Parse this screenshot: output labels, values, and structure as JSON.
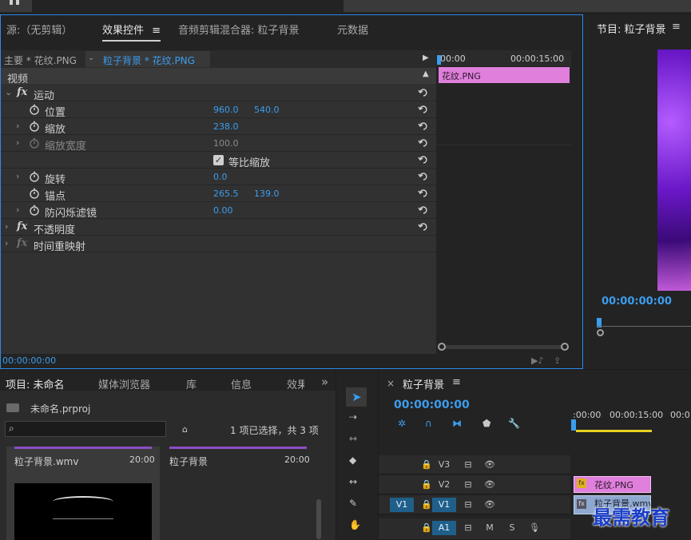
{
  "effect_controls": {
    "tabs": [
      {
        "label": "源:（无剪辑）"
      },
      {
        "label": "效果控件"
      },
      {
        "label": "音频剪辑混合器: 粒子背景"
      },
      {
        "label": "元数据"
      }
    ],
    "menu_glyph": "≡",
    "master_clip": "主要 * 花纹.PNG",
    "sequence_clip": "粒子背景 * 花纹.PNG",
    "section_video": "视频",
    "fx_glyph": "fx",
    "rows": {
      "motion": "运动",
      "position": {
        "label": "位置",
        "x": "960.0",
        "y": "540.0"
      },
      "scale": {
        "label": "缩放",
        "value": "238.0"
      },
      "scale_width": {
        "label": "缩放宽度",
        "value": "100.0"
      },
      "uniform_scale": {
        "label": "等比缩放",
        "checked": true
      },
      "rotation": {
        "label": "旋转",
        "value": "0.0"
      },
      "anchor": {
        "label": "锚点",
        "x": "265.5",
        "y": "139.0"
      },
      "anti_flicker": {
        "label": "防闪烁滤镜",
        "value": "0.00"
      },
      "opacity": "不透明度",
      "time_remap": "时间重映射"
    },
    "timeline": {
      "start": "00:00",
      "mid": "00:00:15:00",
      "clip_label": "花纹.PNG"
    },
    "footer_timecode": "00:00:00:00"
  },
  "program_monitor": {
    "title": "节目: 粒子背景",
    "timecode": "00:00:00:00"
  },
  "project": {
    "tabs": [
      {
        "label": "项目: 未命名"
      },
      {
        "label": "媒体浏览器"
      },
      {
        "label": "库"
      },
      {
        "label": "信息"
      },
      {
        "label": "效果"
      }
    ],
    "overflow_glyph": "»",
    "project_file": "未命名.prproj",
    "selection_status": "1 项已选择，共 3 项",
    "items": [
      {
        "name": "粒子背景.wmv",
        "duration": "20:00"
      },
      {
        "name": "粒子背景",
        "duration": "20:00"
      }
    ]
  },
  "sequence": {
    "title": "粒子背景",
    "close_glyph": "×",
    "menu_glyph": "≡",
    "timecode": "00:00:00:00",
    "ruler": [
      ":00:00",
      "00:00:15:00",
      "00:0"
    ],
    "tracks": [
      {
        "name": "V3"
      },
      {
        "name": "V2"
      },
      {
        "name": "V1",
        "source": "V1"
      },
      {
        "name": "A1",
        "m": "M",
        "s": "S"
      }
    ],
    "clip_v2": "花纹.PNG",
    "clip_v1": "粒子背景.wmv"
  },
  "watermark": "最需教育",
  "colors": {
    "accent": "#3b9ded",
    "clip_pink": "#e07fdc",
    "panel_border": "#2d8ceb"
  }
}
